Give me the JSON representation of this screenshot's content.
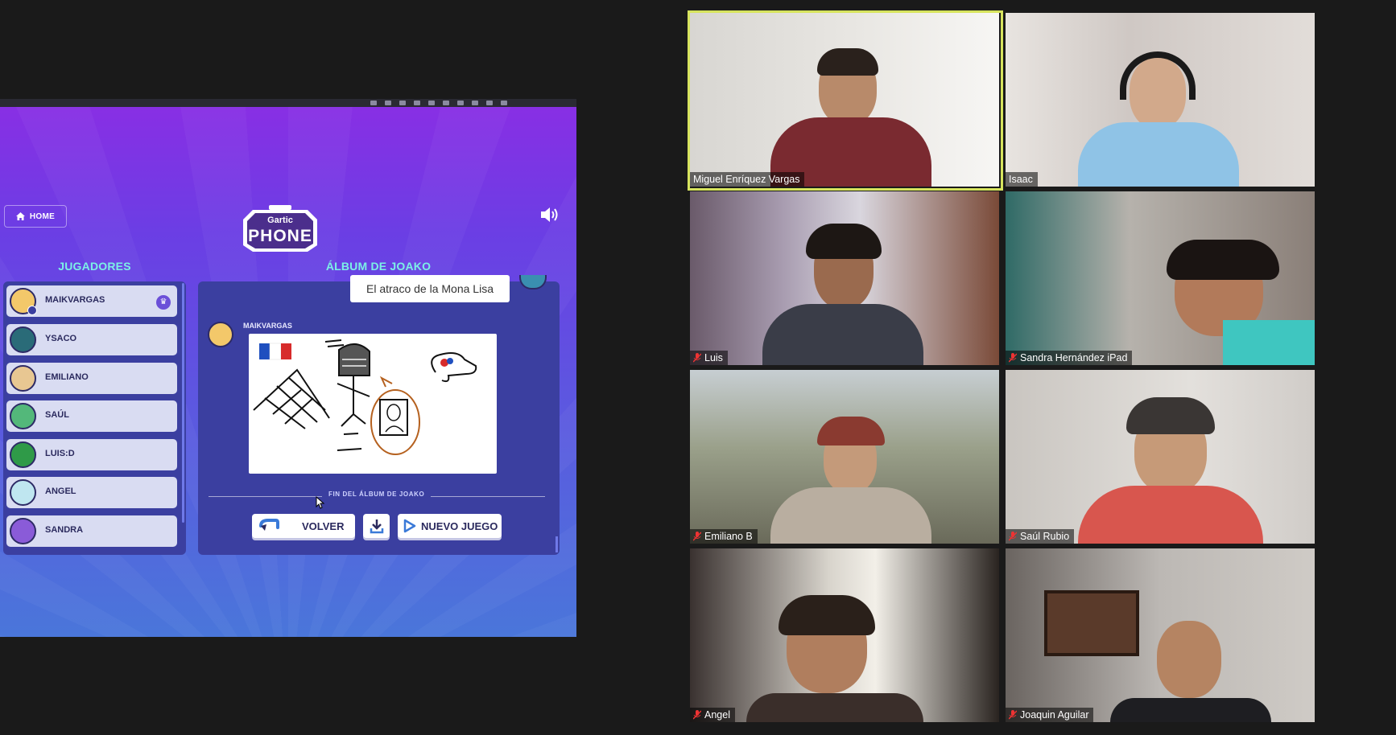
{
  "game": {
    "home_label": "HOME",
    "logo_top": "Gartic",
    "logo_main": "PHONE",
    "players_heading": "JUGADORES",
    "album_heading": "ÁLBUM DE JOAKO",
    "players": [
      {
        "name": "MAIKVARGAS",
        "color": "#f3c86a",
        "host": true
      },
      {
        "name": "YSACO",
        "color": "#2a6b78",
        "host": false
      },
      {
        "name": "EMILIANO",
        "color": "#e8c792",
        "host": false
      },
      {
        "name": "SAÚL",
        "color": "#53b87a",
        "host": false
      },
      {
        "name": "LUIS:D",
        "color": "#2f9a48",
        "host": false
      },
      {
        "name": "ANGEL",
        "color": "#bfe6f0",
        "host": false
      },
      {
        "name": "SANDRA",
        "color": "#8a5bd8",
        "host": false
      }
    ],
    "album": {
      "caption": "El atraco de la Mona Lisa",
      "drawing_author": "MAIKVARGAS",
      "end_label": "FIN DEL ÁLBUM DE JOAKO"
    },
    "buttons": {
      "back": "VOLVER",
      "new_game": "NUEVO JUEGO"
    }
  },
  "meeting": {
    "active_color": "#d7e45e",
    "participants": [
      {
        "name": "Miguel Enríquez Vargas",
        "muted": false,
        "active": true
      },
      {
        "name": "Isaac",
        "muted": false,
        "active": false
      },
      {
        "name": "Luis",
        "muted": true,
        "active": false
      },
      {
        "name": "Sandra Hernández iPad",
        "muted": true,
        "active": false
      },
      {
        "name": "Emiliano B",
        "muted": true,
        "active": false
      },
      {
        "name": "Saúl Rubio",
        "muted": true,
        "active": false
      },
      {
        "name": "Angel",
        "muted": true,
        "active": false
      },
      {
        "name": "Joaquin Aguilar",
        "muted": true,
        "active": false
      }
    ]
  }
}
